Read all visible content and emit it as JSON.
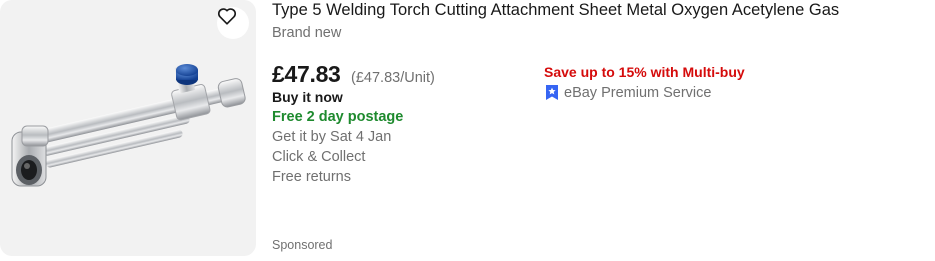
{
  "listing": {
    "image_alt": "Welding torch cutting attachment",
    "watch_icon": "heart-icon",
    "title": "Type 5 Welding Torch Cutting Attachment Sheet Metal Oxygen Acetylene Gas",
    "condition": "Brand new",
    "price": "£47.83",
    "unit_price": "(£47.83/Unit)",
    "buying_format": "Buy it now",
    "postage": "Free 2 day postage",
    "delivery": "Get it by Sat 4 Jan",
    "collect": "Click & Collect",
    "returns": "Free returns",
    "promo": "Save up to 15% with Multi-buy",
    "premium_service": "eBay Premium Service",
    "premium_icon": "premium-badge-icon",
    "sponsored": "Sponsored"
  },
  "colors": {
    "postage_green": "#1e8a2e",
    "promo_red": "#d50b0b",
    "premium_blue": "#3665f3",
    "secondary_text": "#707070"
  }
}
